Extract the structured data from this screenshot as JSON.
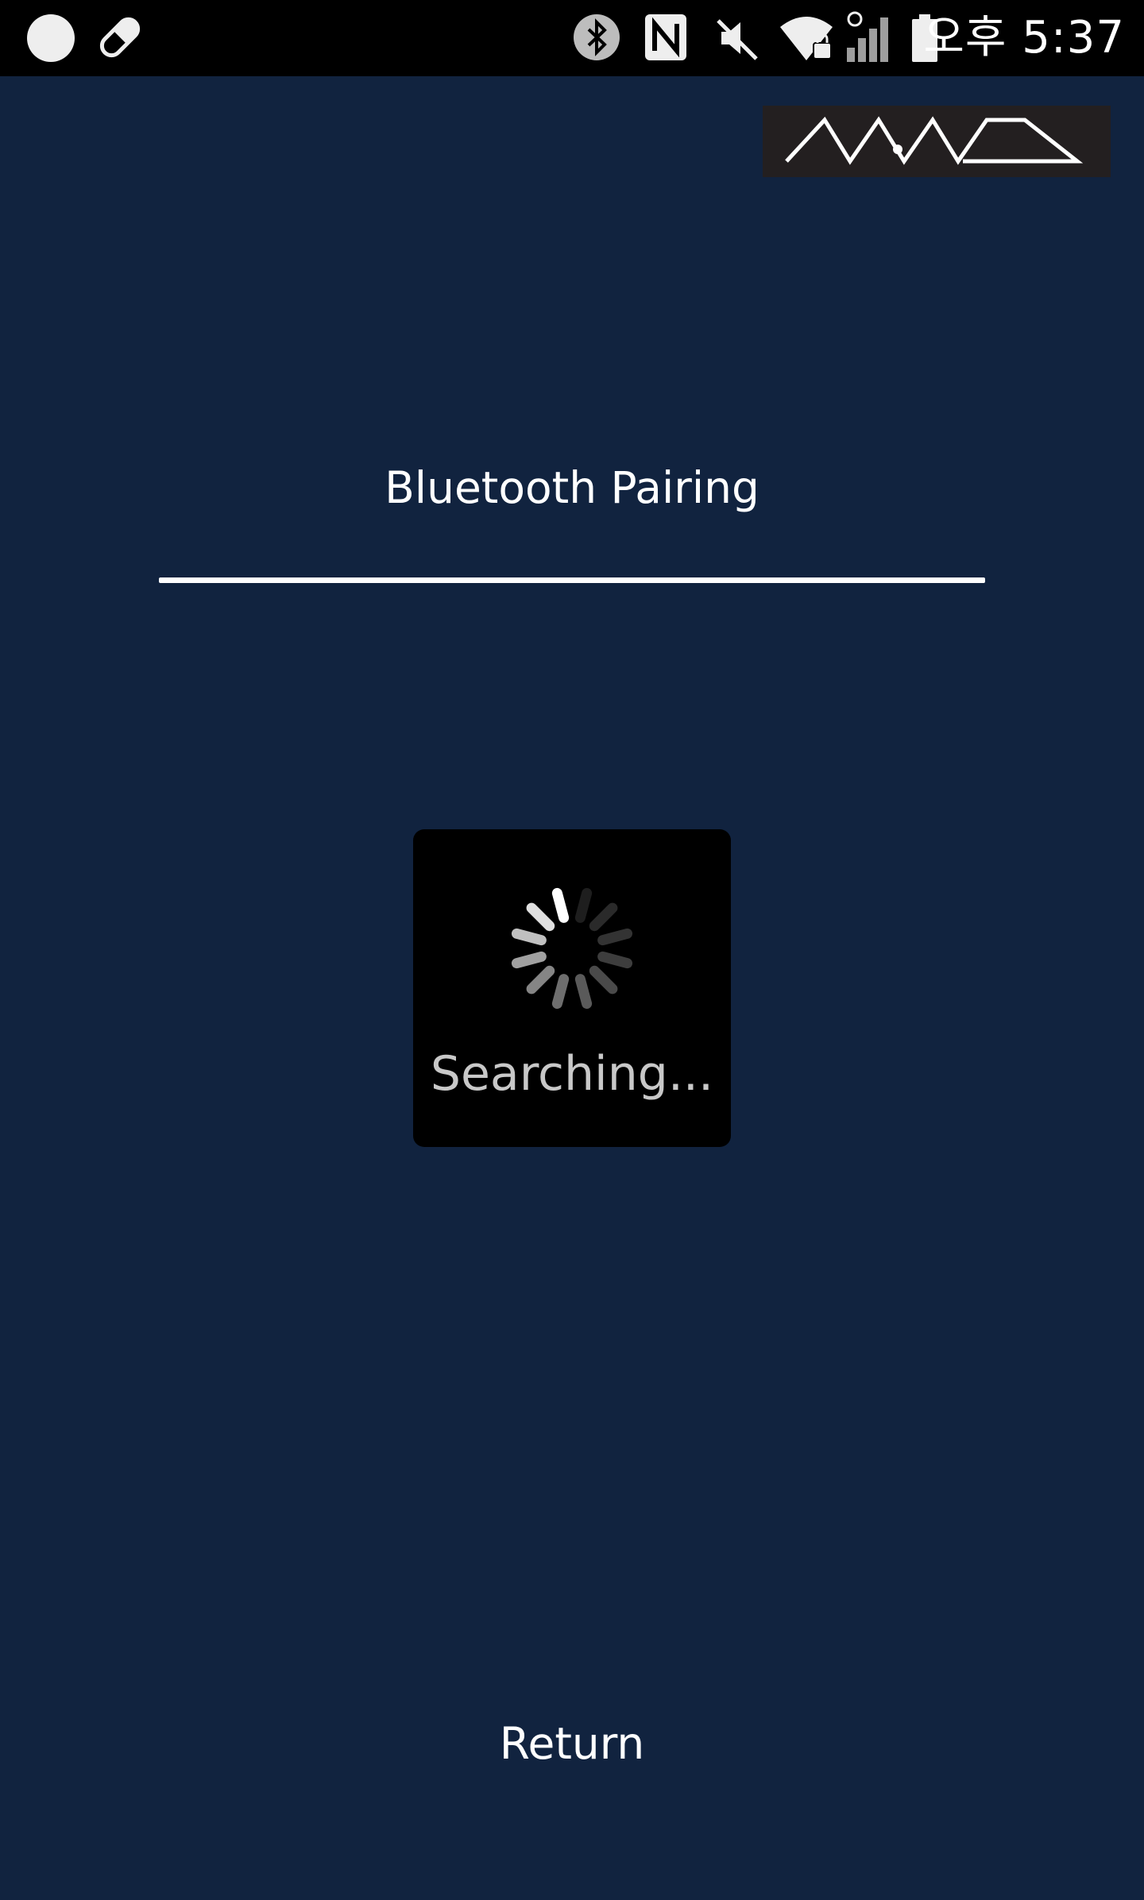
{
  "status_bar": {
    "time": "오후 5:37",
    "icons": [
      "circle-notification-icon",
      "pill-icon",
      "bluetooth-icon",
      "nfc-icon",
      "mute-icon",
      "wifi-lock-icon",
      "signal-icon",
      "battery-icon"
    ]
  },
  "logo": {
    "text": "NAVAS"
  },
  "page": {
    "title": "Bluetooth Pairing"
  },
  "progress": {
    "text": "Searching..."
  },
  "footer": {
    "return_label": "Return"
  },
  "colors": {
    "background": "#11233f",
    "status_bar": "#000000",
    "dialog": "#000000",
    "logo_bg": "#231f20",
    "text": "#ffffff"
  }
}
